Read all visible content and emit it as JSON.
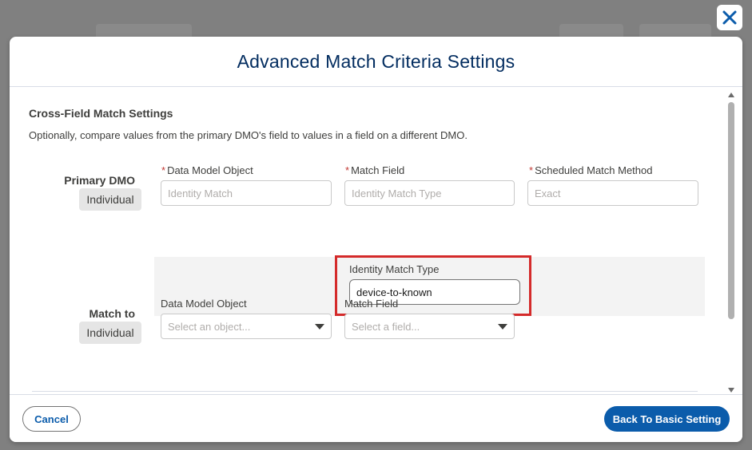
{
  "modal": {
    "title": "Advanced Match Criteria Settings"
  },
  "section": {
    "title": "Cross-Field Match Settings",
    "description": "Optionally, compare values from the primary DMO's field to values in a field on a different DMO."
  },
  "primary": {
    "label": "Primary DMO",
    "pill": "Individual",
    "fields": {
      "dmo_label": "Data Model Object",
      "dmo_placeholder": "Identity Match",
      "match_field_label": "Match Field",
      "match_field_placeholder": "Identity Match Type",
      "method_label": "Scheduled Match Method",
      "method_placeholder": "Exact"
    },
    "required_mark": "*"
  },
  "identity": {
    "label": "Identity Match Type",
    "value": "device-to-known"
  },
  "match_to": {
    "label": "Match to",
    "pill": "Individual",
    "fields": {
      "dmo_label": "Data Model Object",
      "dmo_placeholder": "Select an object...",
      "match_field_label": "Match Field",
      "match_field_placeholder": "Select a field..."
    }
  },
  "footer": {
    "cancel": "Cancel",
    "primary": "Back To Basic Setting"
  },
  "colors": {
    "brand": "#0b5cab",
    "title": "#032d60",
    "highlight": "#d42a2a",
    "required": "#c23934"
  },
  "icons": {
    "close": "close-icon",
    "chevron": "chevron-down-icon"
  }
}
